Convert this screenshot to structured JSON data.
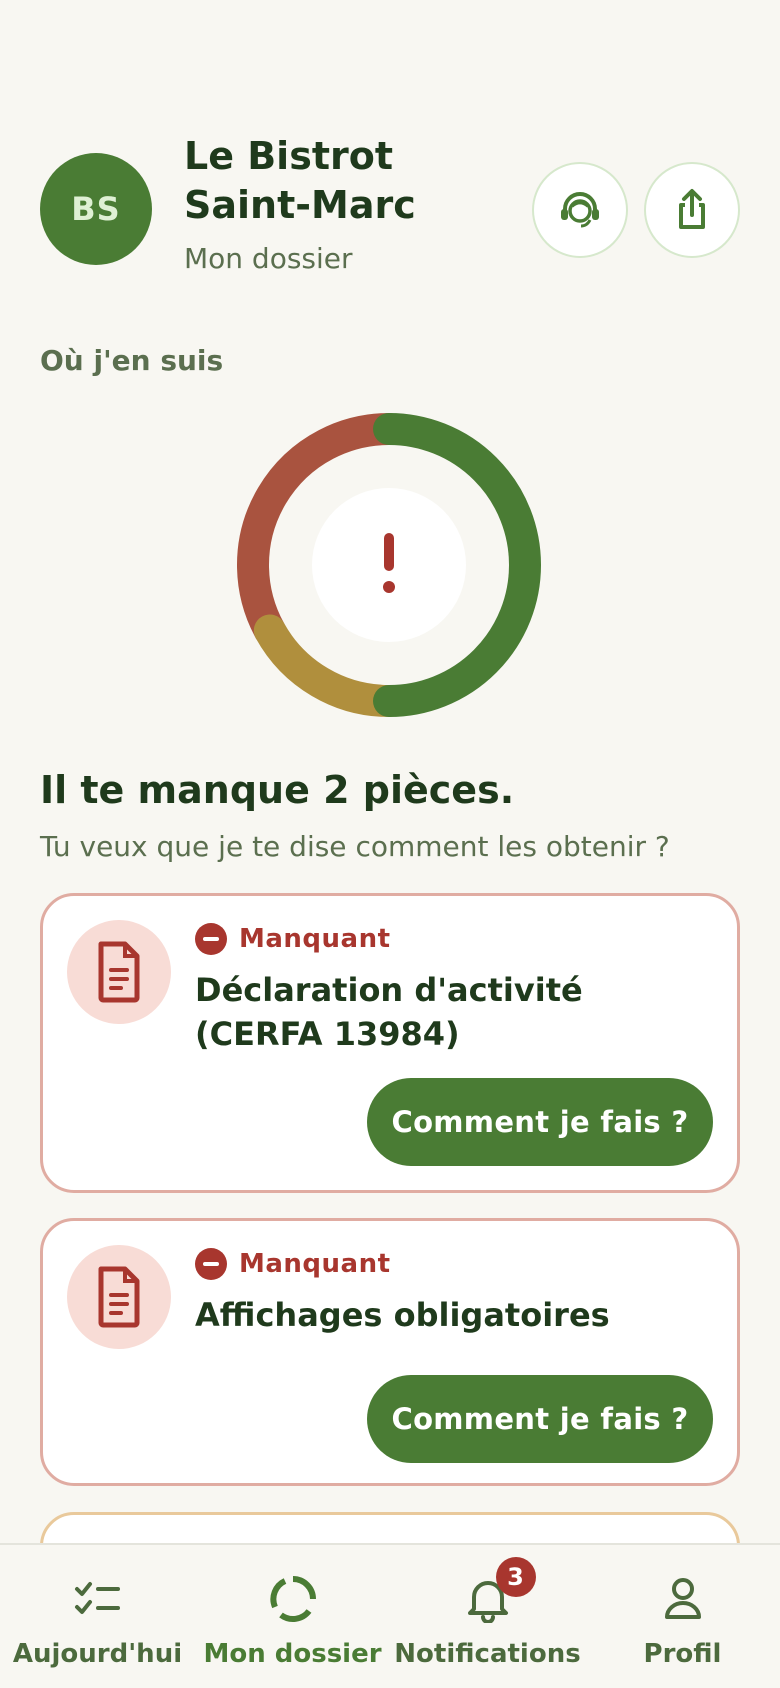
{
  "header": {
    "avatar_initials": "BS",
    "business_name": "Le Bistrot Saint-Marc",
    "subtitle": "Mon dossier",
    "support_icon": "headset-icon",
    "share_icon": "share-icon"
  },
  "progress": {
    "section_label": "Où j'en suis",
    "center_icon": "exclamation-icon",
    "segments": [
      {
        "status": "ok",
        "fraction": 0.5,
        "color": "#4a7c34"
      },
      {
        "status": "pending",
        "fraction": 0.17,
        "color": "#b08f3d"
      },
      {
        "status": "missing",
        "fraction": 0.33,
        "color": "#a9533f"
      }
    ]
  },
  "summary": {
    "headline": "Il te manque 2 pièces.",
    "question": "Tu veux que je te dise comment les obtenir ?"
  },
  "documents": [
    {
      "status": "Manquant",
      "title": "Déclaration d'activité (CERFA 13984)",
      "action": "Comment je fais ?"
    },
    {
      "status": "Manquant",
      "title": "Affichages obligatoires",
      "action": "Comment je fais ?"
    }
  ],
  "nav": {
    "items": [
      {
        "label": "Aujourd'hui",
        "icon": "checklist-icon"
      },
      {
        "label": "Mon dossier",
        "icon": "progress-ring-icon"
      },
      {
        "label": "Notifications",
        "icon": "bell-icon",
        "badge": "3"
      },
      {
        "label": "Profil",
        "icon": "user-icon"
      }
    ],
    "active": "Mon dossier"
  },
  "colors": {
    "accent": "#4a7c34",
    "danger": "#a8362e",
    "warning": "#b08f3d",
    "background": "#f8f7f2"
  }
}
